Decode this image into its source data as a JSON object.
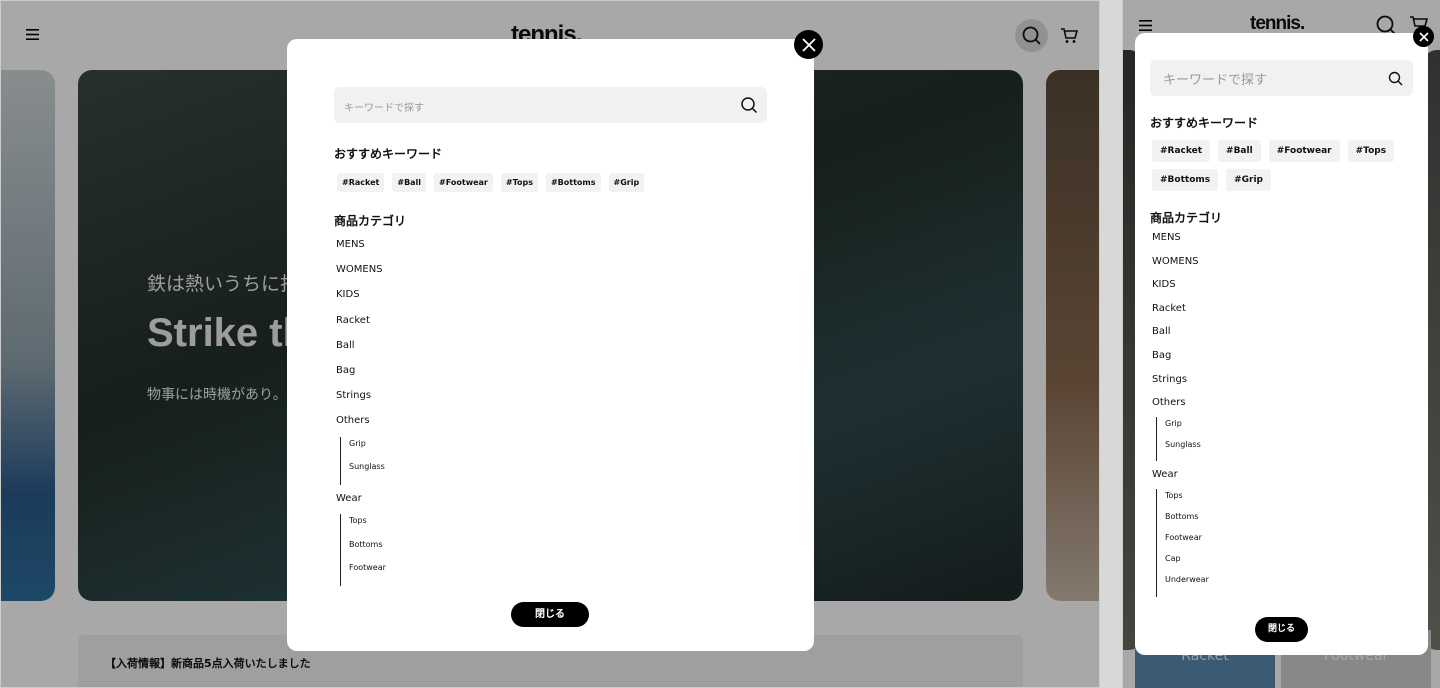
{
  "header": {
    "logo": "tennis.",
    "menu_icon": "hamburger-icon",
    "search_icon": "search-icon",
    "cart_icon": "cart-icon"
  },
  "hero": {
    "title_jp": "鉄は熱いうちに打",
    "title_en": "Strike th",
    "subtitle": "物事には時機があり。"
  },
  "news": {
    "text": "【入荷情報】新商品5点入荷いたしました"
  },
  "search_modal": {
    "placeholder": "キーワードで探す",
    "keywords_heading": "おすすめキーワード",
    "keywords": [
      "#Racket",
      "#Ball",
      "#Footwear",
      "#Tops",
      "#Bottoms",
      "#Grip"
    ],
    "category_heading": "商品カテゴリ",
    "categories": [
      "MENS",
      "WOMENS",
      "KIDS",
      "Racket",
      "Ball",
      "Bag",
      "Strings"
    ],
    "others": {
      "label": "Others",
      "children": [
        "Grip",
        "Sunglass"
      ]
    },
    "wear": {
      "label": "Wear",
      "children": [
        "Tops",
        "Bottoms",
        "Footwear"
      ]
    },
    "wear_mobile": {
      "label": "Wear",
      "children": [
        "Tops",
        "Bottoms",
        "Footwear",
        "Cap",
        "Underwear"
      ]
    },
    "close_label": "閉じる"
  },
  "mobile_behind": {
    "labels": [
      "Racket",
      "Footwear"
    ]
  }
}
